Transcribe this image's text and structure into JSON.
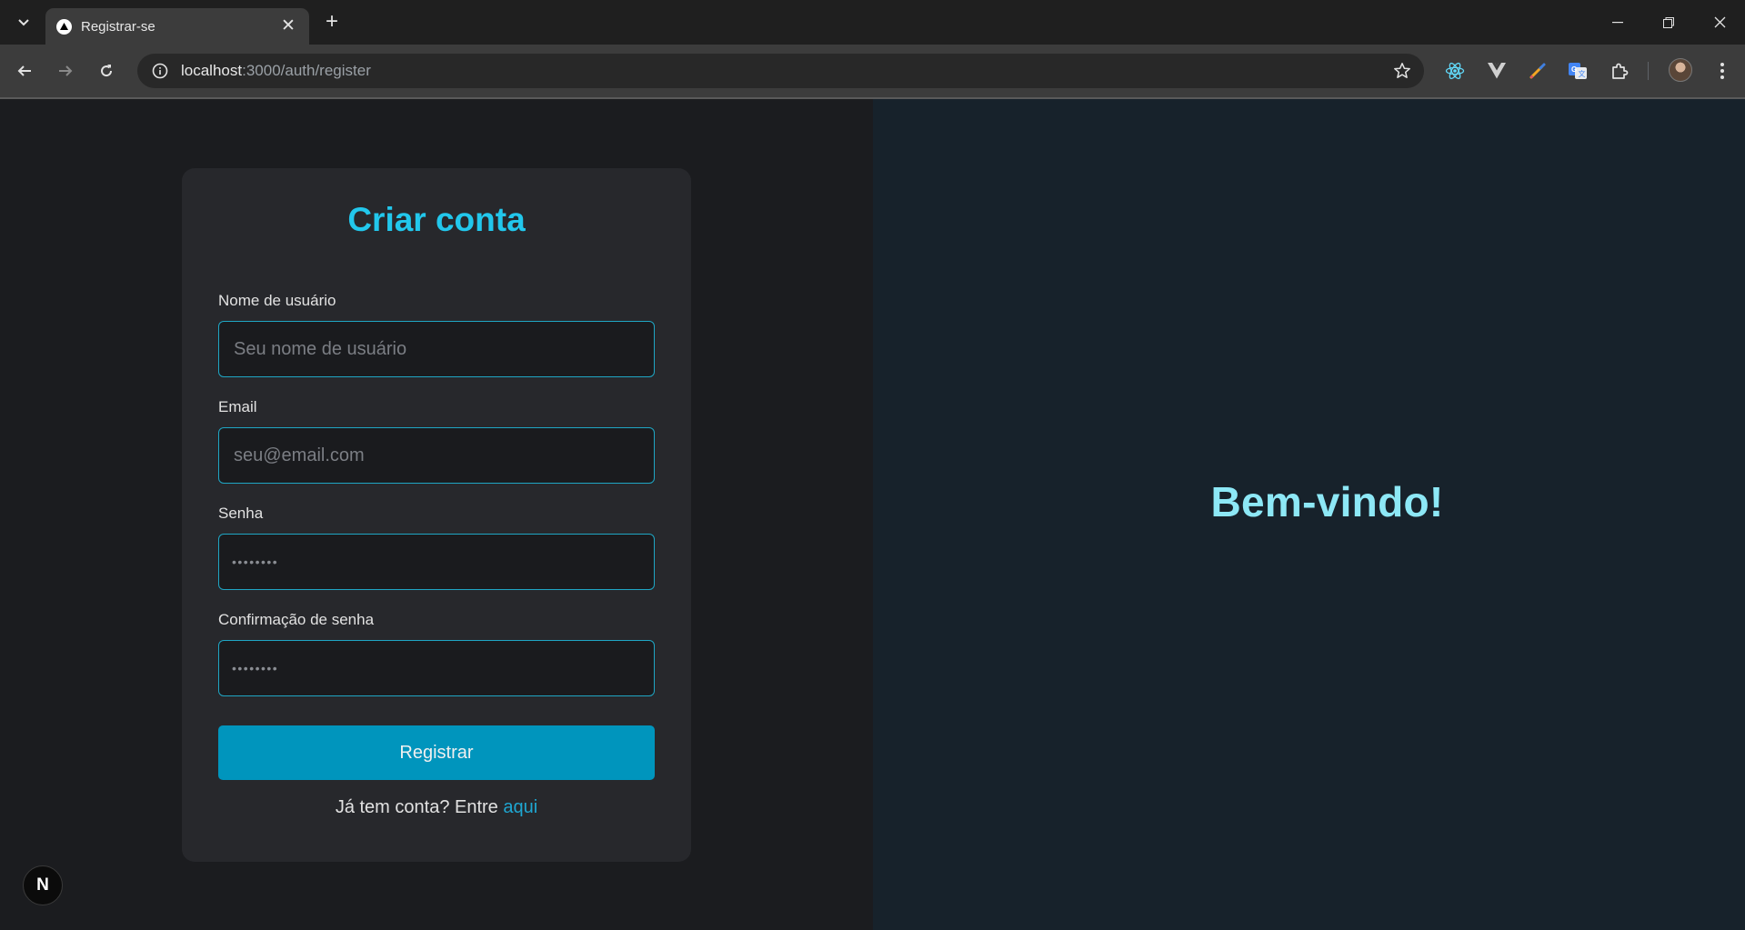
{
  "browser": {
    "tab_title": "Registrar-se",
    "url_host": "localhost",
    "url_path": ":3000/auth/register"
  },
  "form": {
    "title": "Criar conta",
    "username": {
      "label": "Nome de usuário",
      "placeholder": "Seu nome de usuário"
    },
    "email": {
      "label": "Email",
      "placeholder": "seu@email.com"
    },
    "password": {
      "label": "Senha",
      "masked_placeholder": "••••••••"
    },
    "confirm_password": {
      "label": "Confirmação de senha",
      "masked_placeholder": "••••••••"
    },
    "submit_label": "Registrar",
    "login_prompt": "Já tem conta? Entre ",
    "login_link": "aqui"
  },
  "hero": {
    "welcome": "Bem-vindo!"
  },
  "dev_badge": {
    "label": "N"
  },
  "colors": {
    "accent": "#22c7ec",
    "button": "#0095bd",
    "link": "#1fa6d1",
    "welcome": "#8de8f6",
    "left_bg": "#1b1c1f",
    "right_bg": "#17222b",
    "card_bg": "#27282c"
  }
}
